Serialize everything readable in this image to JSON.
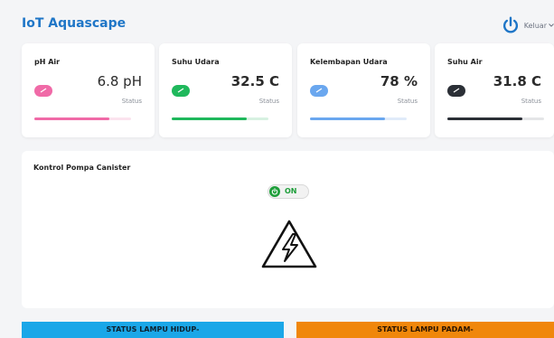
{
  "header": {
    "brand": "IoT Aquascape",
    "logout_label": "Keluar",
    "accent": "#1f76c7"
  },
  "cards": [
    {
      "title": "pH Air",
      "value": "6.8 pH",
      "status": "Status",
      "color": "#f06aa7",
      "track": "#fbe3ee",
      "progress": 0.78
    },
    {
      "title": "Suhu Udara",
      "value": "32.5 C",
      "status": "Status",
      "color": "#1fb85c",
      "track": "#d7f1e1",
      "progress": 0.78
    },
    {
      "title": "Kelembapan Udara",
      "value": "78 %",
      "status": "Status",
      "color": "#6aa7ef",
      "track": "#e0ebf9",
      "progress": 0.78
    },
    {
      "title": "Suhu Air",
      "value": "31.8 C",
      "status": "Status",
      "color": "#2b2f36",
      "track": "#e4e5e7",
      "progress": 0.78
    }
  ],
  "pump": {
    "title": "Kontrol Pompa Canister",
    "toggle_label": "ON",
    "toggle_color": "#1e9e3a"
  },
  "lamps": {
    "on_label": "STATUS LAMPU HIDUP-",
    "off_label": "STATUS LAMPU PADAM-",
    "on_color": "#1aa7e8",
    "off_color": "#f0870b"
  }
}
